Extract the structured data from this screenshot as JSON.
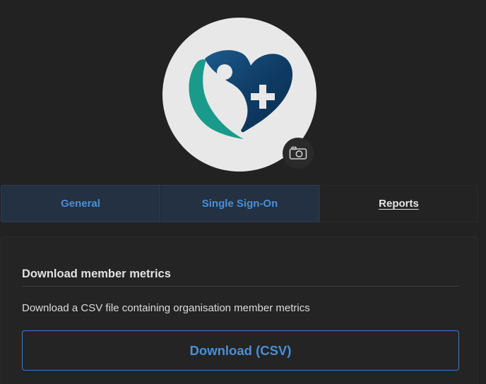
{
  "profile": {
    "logo_icon": "heart-medical-cross-person-logo",
    "camera_icon": "camera-icon"
  },
  "tabs": [
    {
      "label": "General",
      "active": false
    },
    {
      "label": "Single Sign-On",
      "active": false
    },
    {
      "label": "Reports",
      "active": true
    }
  ],
  "reports": {
    "section_title": "Download member metrics",
    "description": "Download a CSV file containing organisation member metrics",
    "download_button": "Download (CSV)"
  },
  "colors": {
    "background": "#222222",
    "accent": "#4a8fd6",
    "tab_inactive_bg": "#243142",
    "logo_navy": "#0f3d66",
    "logo_teal": "#1a9a8a"
  }
}
